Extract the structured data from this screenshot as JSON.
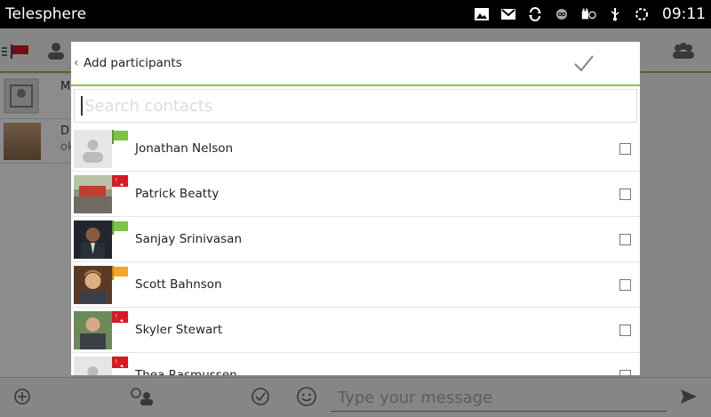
{
  "status_bar": {
    "app_title": "Telesphere",
    "time": "09:11",
    "icons": [
      "image-icon",
      "gmail-icon",
      "sync-icon",
      "voicemail-icon",
      "usb-charge-icon",
      "usb-icon",
      "loading-icon"
    ]
  },
  "background": {
    "preview_name_1": "M",
    "preview_name_2": "D",
    "preview_text_2": "ok",
    "message_placeholder": "Type your message"
  },
  "dialog": {
    "title": "Add participants",
    "search_placeholder": "Search contacts",
    "contacts": [
      {
        "name": "Jonathan Nelson",
        "status": "green-flag",
        "avatar": "default-avatar",
        "checked": false
      },
      {
        "name": "Patrick Beatty",
        "status": "red-phone",
        "avatar": "photo-street",
        "checked": false
      },
      {
        "name": "Sanjay Srinivasan",
        "status": "green-flag",
        "avatar": "photo-suit",
        "checked": false
      },
      {
        "name": "Scott Bahnson",
        "status": "orange-flag",
        "avatar": "photo-smile",
        "checked": false
      },
      {
        "name": "Skyler Stewart",
        "status": "red-phone",
        "avatar": "photo-outdoor",
        "checked": false
      },
      {
        "name": "Thea Rasmussen",
        "status": "red-phone",
        "avatar": "default-avatar",
        "checked": false
      }
    ]
  },
  "colors": {
    "accent_green": "#8bc34a",
    "flag_orange": "#f5a623",
    "flag_red": "#d71920"
  }
}
